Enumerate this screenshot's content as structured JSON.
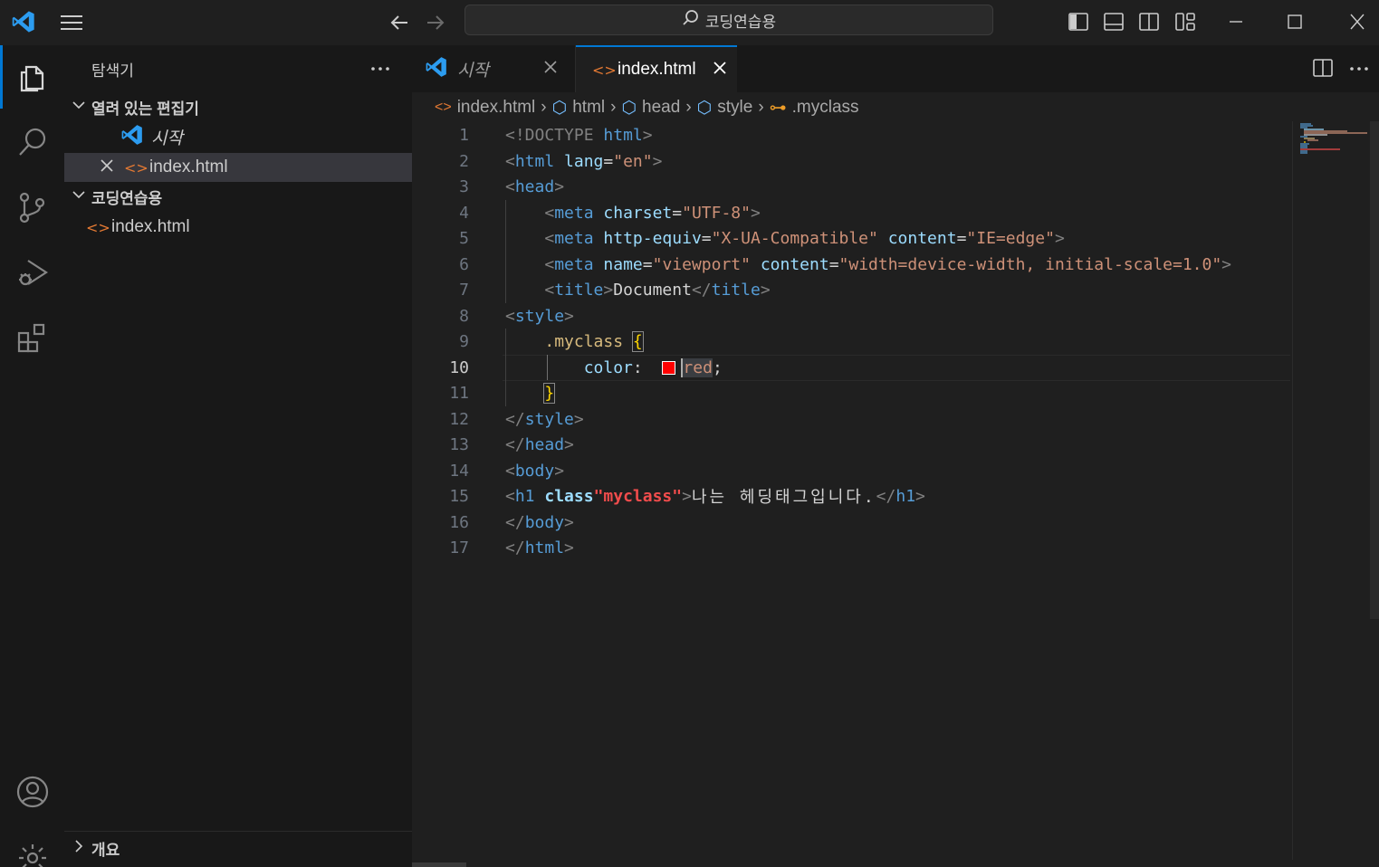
{
  "titlebar": {
    "search_text": "코딩연습용"
  },
  "sidebar": {
    "title": "탐색기",
    "open_editors_header": "열려 있는 편집기",
    "open_editors": [
      {
        "label": "시작",
        "icon": "vscode-logo-icon"
      },
      {
        "label": "index.html",
        "icon": "html-file-icon"
      }
    ],
    "workspace_header": "코딩연습용",
    "workspace_files": [
      {
        "label": "index.html",
        "icon": "html-file-icon"
      }
    ],
    "outline_header": "개요"
  },
  "tabs": [
    {
      "label": "시작",
      "active": false
    },
    {
      "label": "index.html",
      "active": true
    }
  ],
  "breadcrumb": [
    "index.html",
    "html",
    "head",
    "style",
    ".myclass"
  ],
  "editor": {
    "current_line": 10,
    "color_swatch": "#ff0000",
    "line_numbers": [
      "1",
      "2",
      "3",
      "4",
      "5",
      "6",
      "7",
      "8",
      "9",
      "10",
      "11",
      "12",
      "13",
      "14",
      "15",
      "16",
      "17"
    ],
    "code": {
      "l1": [
        "<!DOCTYPE",
        "html",
        ">"
      ],
      "l2": [
        "<",
        "html",
        "lang",
        "=",
        "\"en\"",
        ">"
      ],
      "l3": [
        "<",
        "head",
        ">"
      ],
      "l4": [
        "<",
        "meta",
        "charset",
        "=",
        "\"UTF-8\"",
        ">"
      ],
      "l5": [
        "<",
        "meta",
        "http-equiv",
        "=",
        "\"X-UA-Compatible\"",
        "content",
        "=",
        "\"IE=edge\"",
        ">"
      ],
      "l6": [
        "<",
        "meta",
        "name",
        "=",
        "\"viewport\"",
        "content",
        "=",
        "\"width=device-width, initial-scale=1.0\"",
        ">"
      ],
      "l7": [
        "<",
        "title",
        ">",
        "Document",
        "</",
        "title",
        ">"
      ],
      "l8": [
        "<",
        "style",
        ">"
      ],
      "l9": [
        ".myclass",
        "{"
      ],
      "l10": [
        "color",
        ":",
        "red",
        ";"
      ],
      "l11": [
        "}"
      ],
      "l12": [
        "</",
        "style",
        ">"
      ],
      "l13": [
        "</",
        "head",
        ">"
      ],
      "l14": [
        "<",
        "body",
        ">"
      ],
      "l15": [
        "<",
        "h1",
        "class",
        "\"myclass\"",
        ">",
        "나는 헤딩태그입니다.",
        "</",
        "h1",
        ">"
      ],
      "l16": [
        "</",
        "body",
        ">"
      ],
      "l17": [
        "</",
        "html",
        ">"
      ]
    }
  }
}
